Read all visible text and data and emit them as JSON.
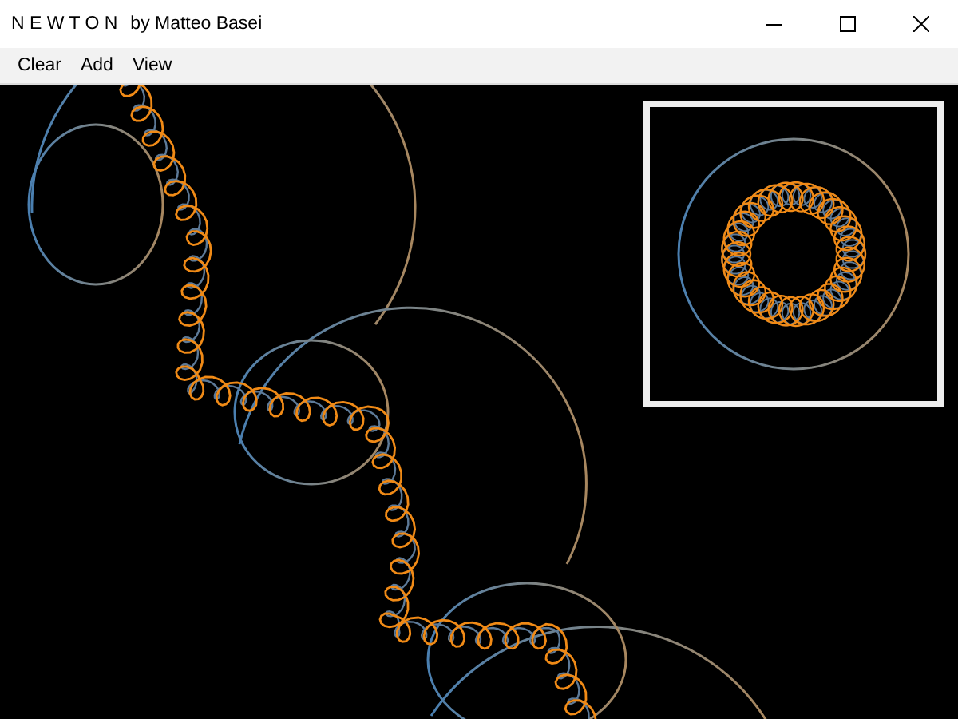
{
  "window": {
    "app_name": "N E W T O N",
    "author": "by Matteo Basei"
  },
  "menu": [
    {
      "label": "Clear"
    },
    {
      "label": "Add"
    },
    {
      "label": "View"
    }
  ]
}
